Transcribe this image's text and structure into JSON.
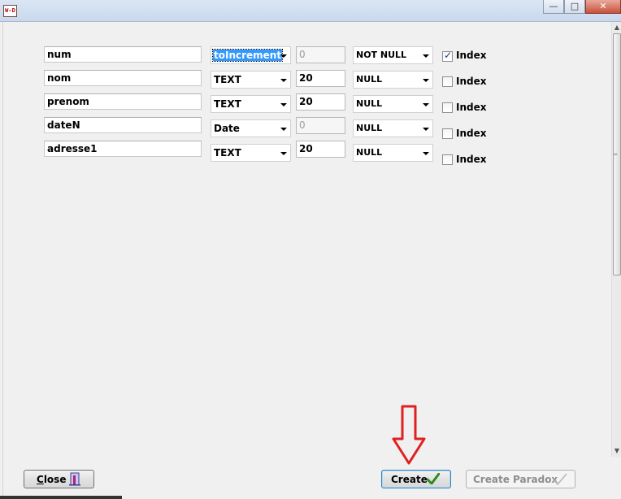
{
  "window": {
    "icon_text": "W-D",
    "controls": {
      "minimize": "—",
      "maximize": "□",
      "close": "✕"
    }
  },
  "fields": [
    {
      "name": "num",
      "type": "toIncrement",
      "type_selected": true,
      "size": "0",
      "size_disabled": true,
      "null_option": "NOT NULL",
      "index_checked": true,
      "index_label": "Index"
    },
    {
      "name": "nom",
      "type": "TEXT",
      "type_selected": false,
      "size": "20",
      "size_disabled": false,
      "null_option": "NULL",
      "index_checked": false,
      "index_label": "Index"
    },
    {
      "name": "prenom",
      "type": "TEXT",
      "type_selected": false,
      "size": "20",
      "size_disabled": false,
      "null_option": "NULL",
      "index_checked": false,
      "index_label": "Index"
    },
    {
      "name": "dateN",
      "type": "Date",
      "type_selected": false,
      "size": "0",
      "size_disabled": true,
      "null_option": "NULL",
      "index_checked": false,
      "index_label": "Index"
    },
    {
      "name": "adresse1",
      "type": "TEXT",
      "type_selected": false,
      "size": "20",
      "size_disabled": false,
      "null_option": "NULL",
      "index_checked": false,
      "index_label": "Index"
    }
  ],
  "buttons": {
    "close": {
      "label": "Close",
      "accel": "C",
      "rest": "lose"
    },
    "create": {
      "label": "Create"
    },
    "create_paradox": {
      "label": "Create Paradox"
    }
  },
  "colors": {
    "selection": "#3399ff",
    "annotation_arrow": "#e02020",
    "create_check": "#2f8a1c"
  }
}
